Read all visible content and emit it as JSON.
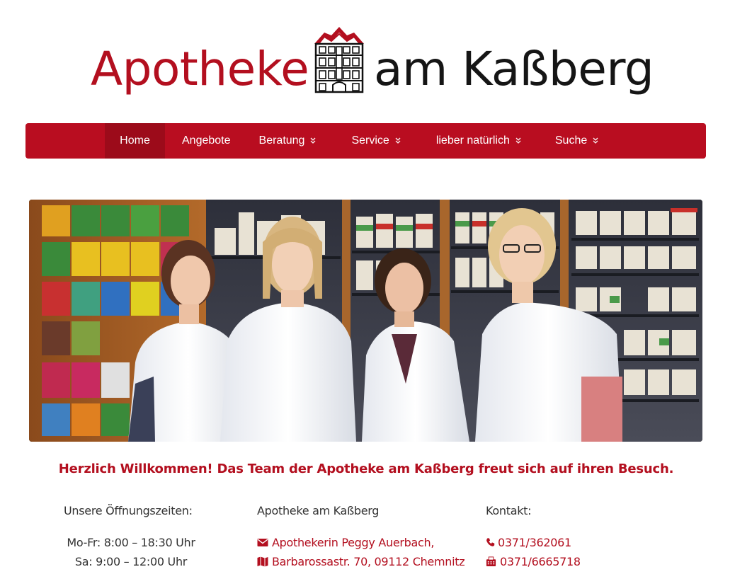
{
  "logo": {
    "word_left": "Apotheke",
    "word_right": "am Kaßberg",
    "icon": "pharmacy-building-icon"
  },
  "nav": {
    "items": [
      {
        "label": "Home",
        "active": true,
        "has_dropdown": false
      },
      {
        "label": "Angebote",
        "active": false,
        "has_dropdown": false
      },
      {
        "label": "Beratung",
        "active": false,
        "has_dropdown": true
      },
      {
        "label": "Service",
        "active": false,
        "has_dropdown": true
      },
      {
        "label": "lieber natürlich",
        "active": false,
        "has_dropdown": true
      },
      {
        "label": "Suche",
        "active": false,
        "has_dropdown": true
      }
    ],
    "dropdown_glyph": "»"
  },
  "hero": {
    "icon": "team-photo"
  },
  "welcome": {
    "text": "Herzlich Willkommen! Das Team der Apotheke am Kaßberg freut sich auf ihren Besuch."
  },
  "hours": {
    "heading": "Unsere Öffnungszeiten:",
    "weekdays": "Mo-Fr: 8:00 – 18:30 Uhr",
    "saturday": "Sa: 9:00 – 12:00 Uhr"
  },
  "address": {
    "heading": "Apotheke am Kaßberg",
    "owner": "Apothekerin Peggy Auerbach,",
    "street": "Barbarossastr. 70, 09112 Chemnitz",
    "owner_icon": "envelope-icon",
    "street_icon": "map-icon"
  },
  "contact": {
    "heading": "Kontakt:",
    "phone": "0371/362061",
    "fax": "0371/6665718",
    "phone_icon": "phone-icon",
    "fax_icon": "fax-icon"
  },
  "colors": {
    "brand_red": "#b90d20",
    "nav_active": "#9c0b1a",
    "text_red": "#b30f1f"
  }
}
